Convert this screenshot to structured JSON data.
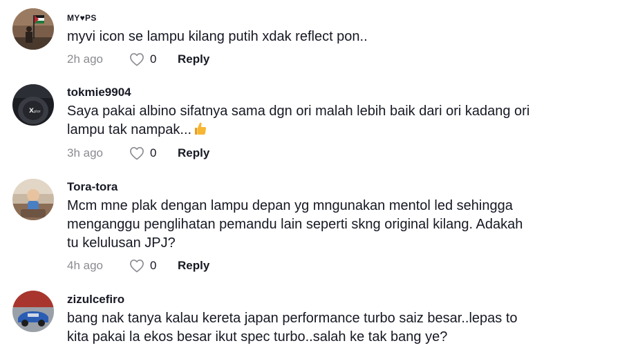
{
  "comments": [
    {
      "username": "MY♥PS",
      "text": [
        "myvi icon se lampu kilang putih xdak reflect pon.."
      ],
      "time": "2h ago",
      "likes": "0",
      "reply_label": "Reply"
    },
    {
      "username": "tokmie9904",
      "text": [
        "Saya pakai albino sifatnya sama dgn ori malah lebih baik dari ori kadang ori",
        "lampu tak nampak..."
      ],
      "emoji": "thumbs-up",
      "time": "3h ago",
      "likes": "0",
      "reply_label": "Reply"
    },
    {
      "username": "Tora-tora",
      "text": [
        "Mcm mne plak dengan lampu depan yg mngunakan mentol led sehingga",
        "menganggu penglihatan pemandu lain seperti skng original kilang. Adakah",
        "tu kelulusan JPJ?"
      ],
      "time": "4h ago",
      "likes": "0",
      "reply_label": "Reply"
    },
    {
      "username": "zizulcefiro",
      "text": [
        "bang nak tanya kalau kereta japan performance turbo saiz besar..lepas to",
        "kita pakai la ekos besar ikut spec turbo..salah ke tak bang ye?"
      ]
    }
  ],
  "colors": {
    "text": "#161823",
    "muted": "#8a8b91",
    "background": "#ffffff"
  },
  "icons": {
    "like": "heart-outline-icon",
    "emoji": "thumbs-up-emoji"
  }
}
